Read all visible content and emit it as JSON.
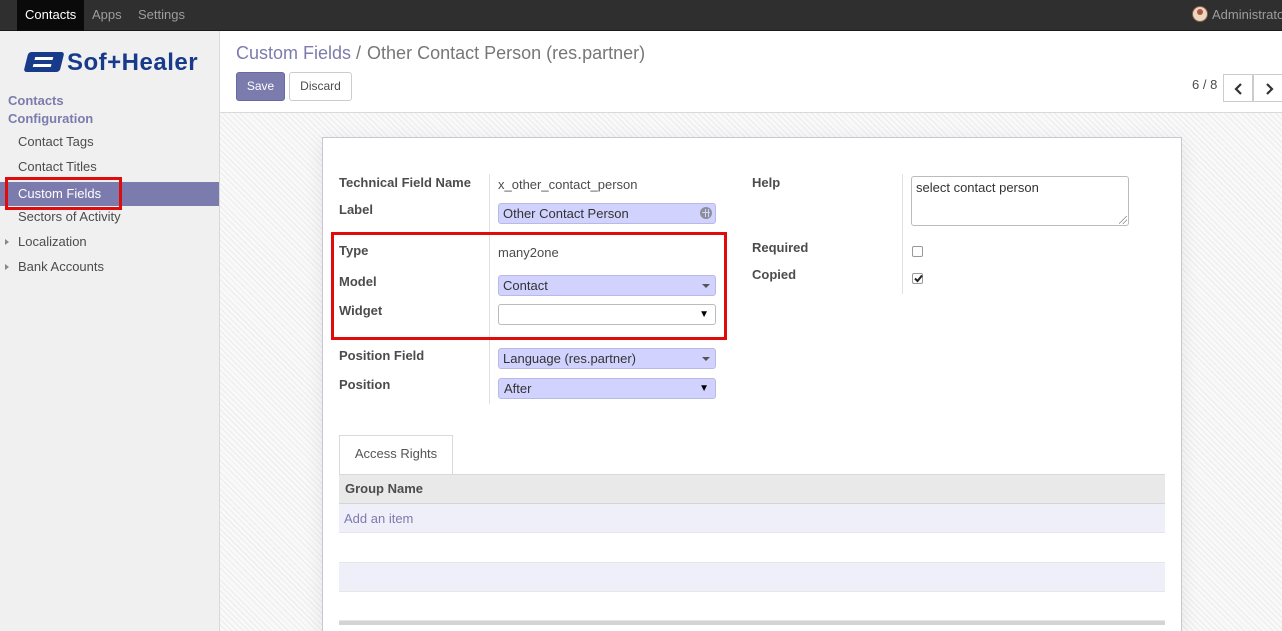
{
  "topbar": {
    "menus": [
      "Contacts",
      "Apps",
      "Settings"
    ],
    "user": "Administrato"
  },
  "logo": {
    "brand": "Sof+Healer"
  },
  "sidebar": {
    "section1": "Contacts",
    "section2": "Configuration",
    "items": [
      {
        "label": "Contact Tags"
      },
      {
        "label": "Contact Titles"
      },
      {
        "label": "Custom Fields"
      },
      {
        "label": "Sectors of Activity"
      },
      {
        "label": "Localization"
      },
      {
        "label": "Bank Accounts"
      }
    ]
  },
  "control": {
    "breadcrumb_parent": "Custom Fields",
    "breadcrumb_sep": "/",
    "breadcrumb_current": "Other Contact Person (res.partner)",
    "save": "Save",
    "discard": "Discard",
    "pager": "6 / 8"
  },
  "form": {
    "technical_label": "Technical Field Name",
    "technical_value": "x_other_contact_person",
    "label_label": "Label",
    "label_value": "Other Contact Person",
    "type_label": "Type",
    "type_value": "many2one",
    "model_label": "Model",
    "model_value": "Contact",
    "widget_label": "Widget",
    "widget_value": "",
    "position_field_label": "Position Field",
    "position_field_value": "Language (res.partner)",
    "position_label": "Position",
    "position_value": "After",
    "help_label": "Help",
    "help_value": "select contact person",
    "required_label": "Required",
    "required_checked": false,
    "copied_label": "Copied",
    "copied_checked": true
  },
  "notebook": {
    "tab": "Access Rights",
    "column": "Group Name",
    "add_item": "Add an item"
  },
  "colors": {
    "accent": "#7c7bad",
    "highlight": "#e00b0b",
    "field_bg": "#d2d2ff"
  }
}
